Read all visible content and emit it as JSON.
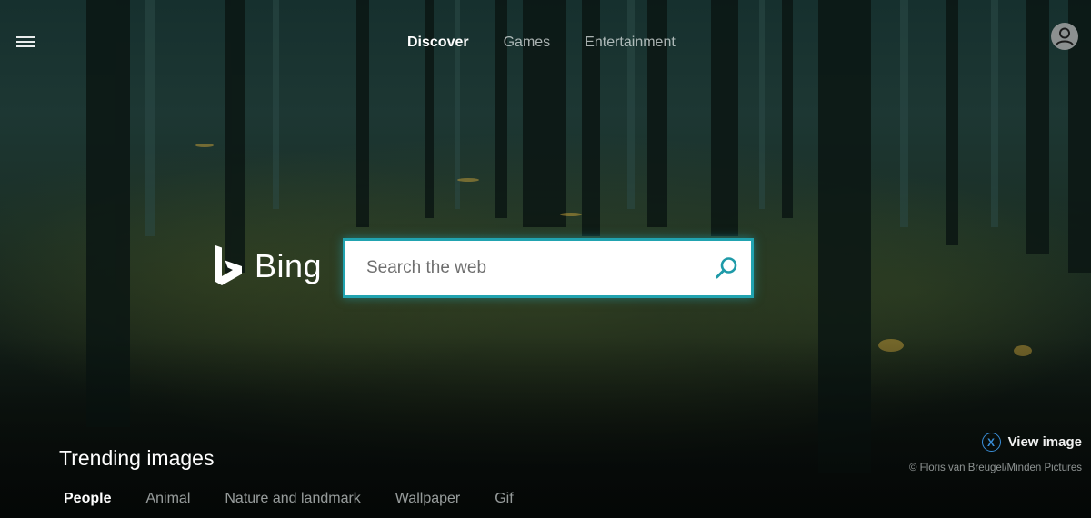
{
  "menu": {
    "icon": "hamburger-menu-icon"
  },
  "nav": {
    "items": [
      {
        "label": "Discover",
        "active": true
      },
      {
        "label": "Games",
        "active": false
      },
      {
        "label": "Entertainment",
        "active": false
      }
    ]
  },
  "profile": {
    "icon": "user-avatar-icon"
  },
  "brand": {
    "logo_text": "Bing",
    "icon": "bing-logo-icon"
  },
  "search": {
    "placeholder": "Search the web",
    "value": "",
    "icon": "search-icon",
    "accent": "#21a3b0"
  },
  "trending": {
    "title": "Trending images",
    "tabs": [
      {
        "label": "People",
        "active": true
      },
      {
        "label": "Animal",
        "active": false
      },
      {
        "label": "Nature and landmark",
        "active": false
      },
      {
        "label": "Wallpaper",
        "active": false
      },
      {
        "label": "Gif",
        "active": false
      }
    ]
  },
  "view_image": {
    "badge": "X",
    "label": "View image",
    "badge_color": "#3a8fd9"
  },
  "copyright": "© Floris van Breugel/Minden Pictures"
}
